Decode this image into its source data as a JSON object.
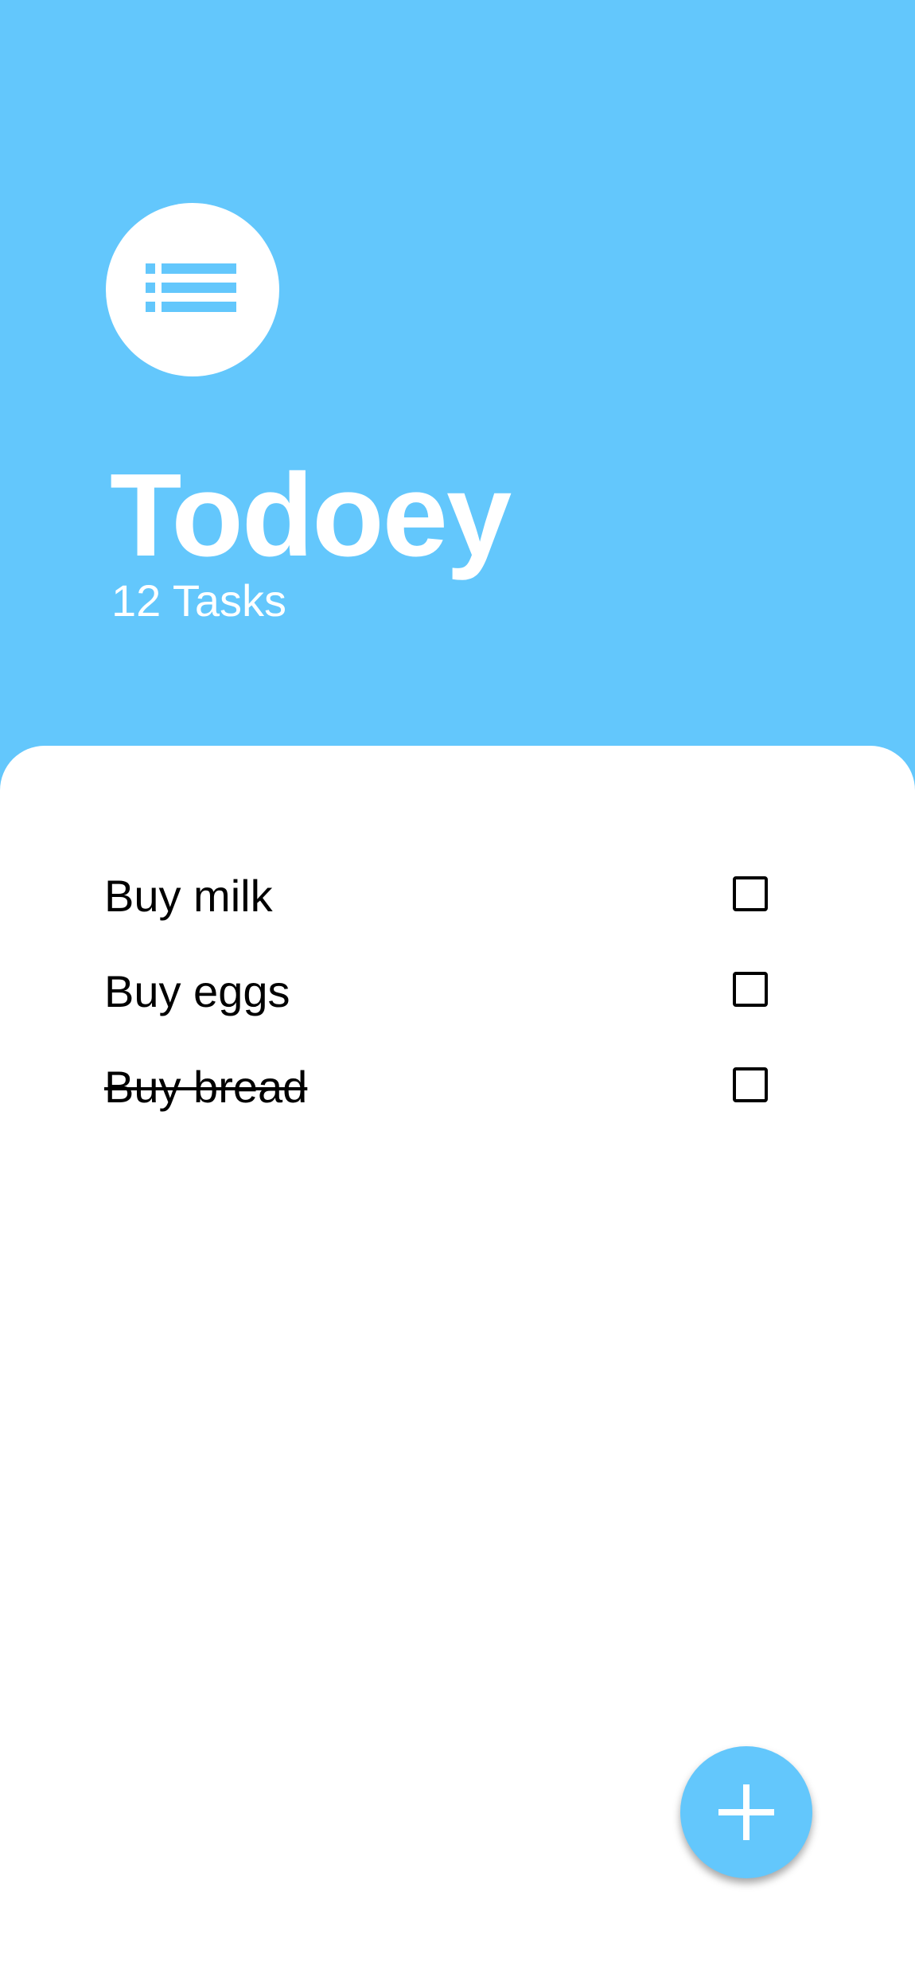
{
  "colors": {
    "accent": "#63C7FC",
    "sheet_background": "#FFFFFF",
    "text_dark": "#000000",
    "text_light": "#FFFFFF"
  },
  "header": {
    "icon": "list-icon",
    "title": "Todoey",
    "task_count": "12 Tasks"
  },
  "tasks": [
    {
      "label": "Buy milk",
      "done": false,
      "checked": false
    },
    {
      "label": "Buy eggs",
      "done": false,
      "checked": false
    },
    {
      "label": "Buy bread",
      "done": true,
      "checked": false
    }
  ],
  "fab": {
    "icon": "plus-icon"
  }
}
